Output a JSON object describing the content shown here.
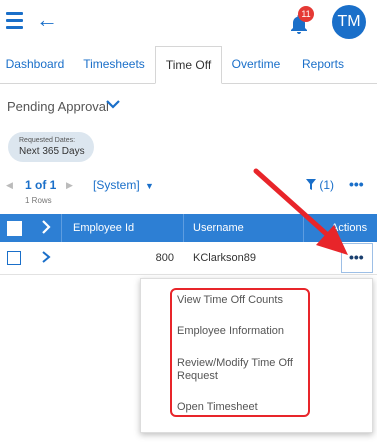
{
  "header": {
    "notification_count": "11",
    "avatar_initials": "TM"
  },
  "tabs": [
    {
      "label": "Dashboard"
    },
    {
      "label": "Timesheets"
    },
    {
      "label": "Time Off"
    },
    {
      "label": "Overtime"
    },
    {
      "label": "Reports"
    }
  ],
  "active_tab": "Time Off",
  "view": {
    "title": "Pending Approval"
  },
  "filter_chip": {
    "label": "Requested Dates:",
    "value": "Next 365 Days"
  },
  "pagination": {
    "page_text": "1 of 1",
    "rows_text": "1 Rows",
    "view_select": "[System]",
    "filter_count": "(1)"
  },
  "table": {
    "columns": [
      "Employee Id",
      "Username",
      "Actions"
    ],
    "rows": [
      {
        "employee_id": "800",
        "username": "KClarkson89"
      }
    ]
  },
  "action_menu": {
    "items": [
      "View Time Off Counts",
      "Employee Information",
      "Review/Modify Time Off Request",
      "Open Timesheet"
    ]
  },
  "colors": {
    "accent": "#1a6fc9",
    "table_header": "#2d7fd4",
    "badge": "#e53935",
    "annotation": "#e8252a"
  },
  "icons": [
    "hamburger-icon",
    "back-arrow-icon",
    "bell-icon",
    "chevron-down-icon",
    "filter-icon",
    "more-icon",
    "chevron-right-icon"
  ]
}
